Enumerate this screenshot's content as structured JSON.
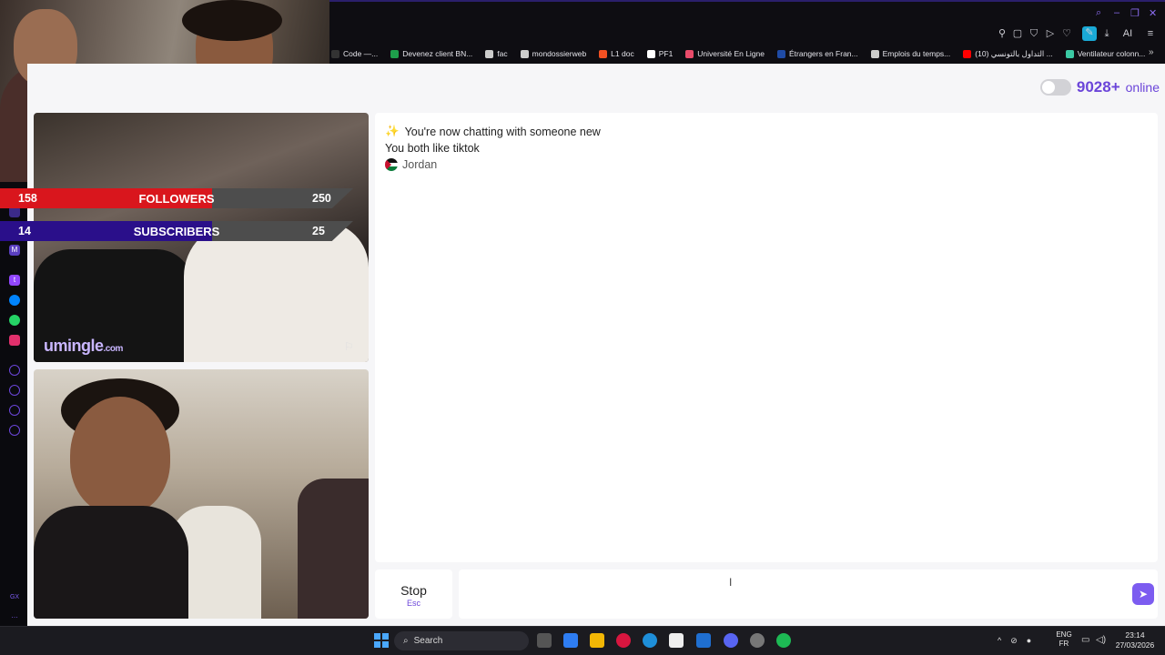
{
  "browser": {
    "bookmarks": [
      {
        "label": "Code —...",
        "color": "#333333"
      },
      {
        "label": "Devenez client BN...",
        "color": "#1e9e4b"
      },
      {
        "label": "fac",
        "color": "#cccccc"
      },
      {
        "label": "mondossierweb",
        "color": "#cccccc"
      },
      {
        "label": "L1 doc",
        "color": "#f25022"
      },
      {
        "label": "PF1",
        "color": "#ffffff"
      },
      {
        "label": "Université En Ligne",
        "color": "#e94b6a"
      },
      {
        "label": "Étrangers en Fran...",
        "color": "#1f4ba5"
      },
      {
        "label": "Emplois du temps...",
        "color": "#cccccc"
      },
      {
        "label": "التداول بالتونسي (10) ...",
        "color": "#ff0000"
      },
      {
        "label": "Ventilateur colonn...",
        "color": "#3bc9a4"
      }
    ],
    "toolbar_icons": [
      "pin-icon",
      "screenshot-icon",
      "shield-icon",
      "play-icon",
      "heart-icon",
      "extension-icon",
      "download-icon",
      "ai-icon",
      "menu-icon"
    ],
    "toolbar_ai_label": "AI"
  },
  "page": {
    "online": {
      "count": "9028+",
      "label": "online"
    },
    "messages": {
      "new_chat_emoji": "✨",
      "new_chat": "You're now chatting with someone new",
      "shared_interest": "You both like tiktok",
      "country": "Jordan"
    },
    "stop": {
      "label": "Stop",
      "key": "Esc"
    },
    "chat_input": {
      "value": "",
      "placeholder": ""
    },
    "logo": {
      "name": "umingle",
      "suffix": ".com"
    }
  },
  "stream_overlay": {
    "followers": {
      "current": "158",
      "label": "FOLLOWERS",
      "goal": "250"
    },
    "subscribers": {
      "current": "14",
      "label": "SUBSCRIBERS",
      "goal": "25"
    }
  },
  "taskbar": {
    "search_label": "Search",
    "lang": [
      "ENG",
      "FR"
    ],
    "time": "23:14",
    "date": "27/03/2026"
  },
  "colors": {
    "accent": "#6b45d9",
    "followers_bar": "#d9161d",
    "subscribers_bar": "#2a0f8a"
  }
}
